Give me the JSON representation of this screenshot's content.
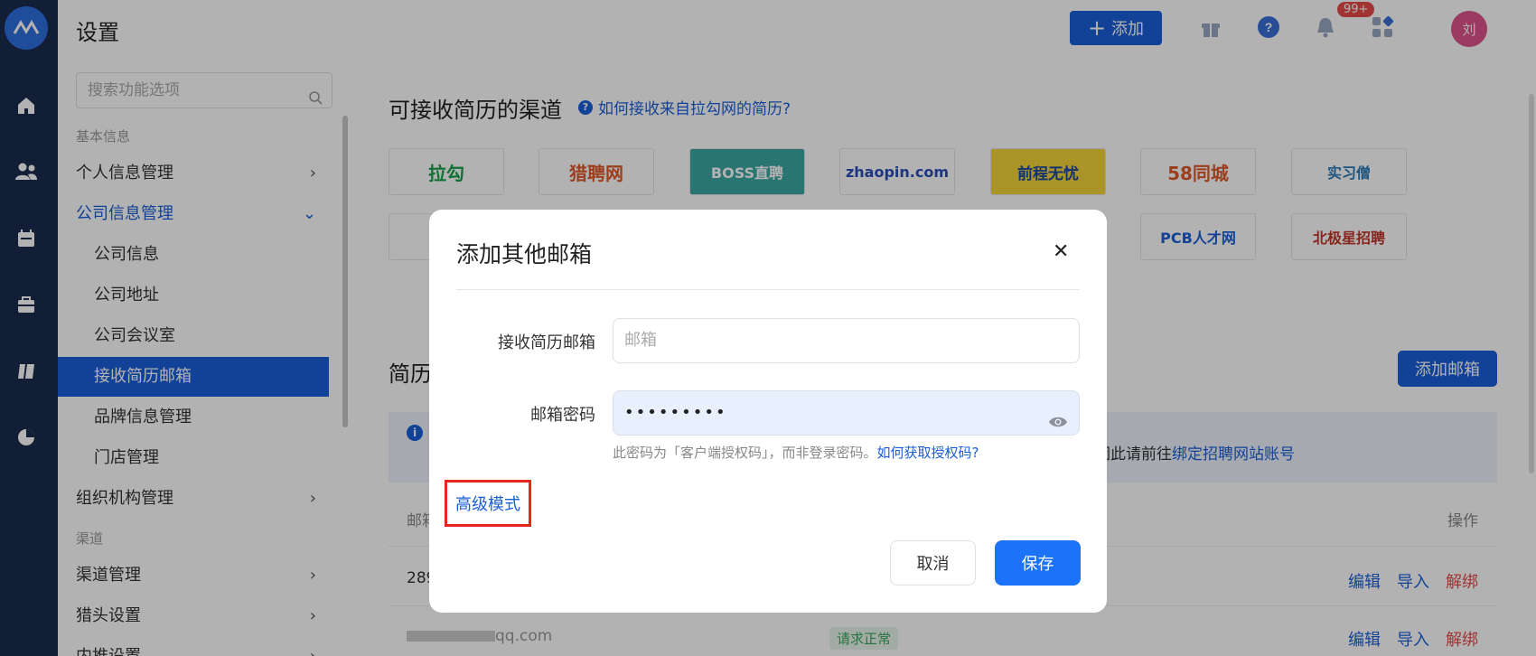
{
  "app": {
    "logo": "logo-icon"
  },
  "rail": {
    "items": [
      "home-icon",
      "people-icon",
      "calendar-icon",
      "briefcase-icon",
      "book-icon",
      "pie-chart-icon"
    ]
  },
  "sidebar": {
    "title": "设置",
    "search_placeholder": "搜索功能选项",
    "group_basic": "基本信息",
    "group_channel": "渠道",
    "items": [
      {
        "label": "个人信息管理"
      },
      {
        "label": "公司信息管理"
      },
      {
        "label": "公司信息"
      },
      {
        "label": "公司地址"
      },
      {
        "label": "公司会议室"
      },
      {
        "label": "接收简历邮箱"
      },
      {
        "label": "品牌信息管理"
      },
      {
        "label": "门店管理"
      },
      {
        "label": "组织机构管理"
      },
      {
        "label": "渠道管理"
      },
      {
        "label": "猎头设置"
      },
      {
        "label": "内推设置"
      }
    ]
  },
  "header": {
    "add_label": "添加",
    "notif_count": "99+",
    "avatar_text": "刘"
  },
  "main": {
    "channels_title": "可接收简历的渠道",
    "help_link": "如何接收来自拉勾网的简历?",
    "channels": [
      "拉勾",
      "猎聘网",
      "BOSS直聘",
      "zhaopin.com",
      "前程无忧",
      "58同城",
      "实习僧",
      "PCB人才网",
      "北极星招聘"
    ],
    "emails_title": "简历",
    "add_email_label": "添加邮箱",
    "notice_tail": "因此请前往",
    "notice_link": "绑定招聘网站账号",
    "col_email": "邮箱",
    "col_ops": "操作",
    "rows": [
      {
        "email": "289",
        "status": "",
        "edit": "编辑",
        "import": "导入",
        "unbind": "解绑"
      },
      {
        "email": "qq.com",
        "status": "请求正常",
        "edit": "编辑",
        "import": "导入",
        "unbind": "解绑"
      }
    ]
  },
  "dialog": {
    "title": "添加其他邮箱",
    "email_label": "接收简历邮箱",
    "email_placeholder": "邮箱",
    "password_label": "邮箱密码",
    "password_value": "•••••••••",
    "hint": "此密码为「客户端授权码」，而非登录密码。",
    "hint_link": "如何获取授权码?",
    "advanced": "高级模式",
    "cancel": "取消",
    "save": "保存"
  },
  "colors": {
    "primary": "#1a5fd8",
    "rail": "#1b2a4e",
    "danger": "#e84a4a"
  }
}
